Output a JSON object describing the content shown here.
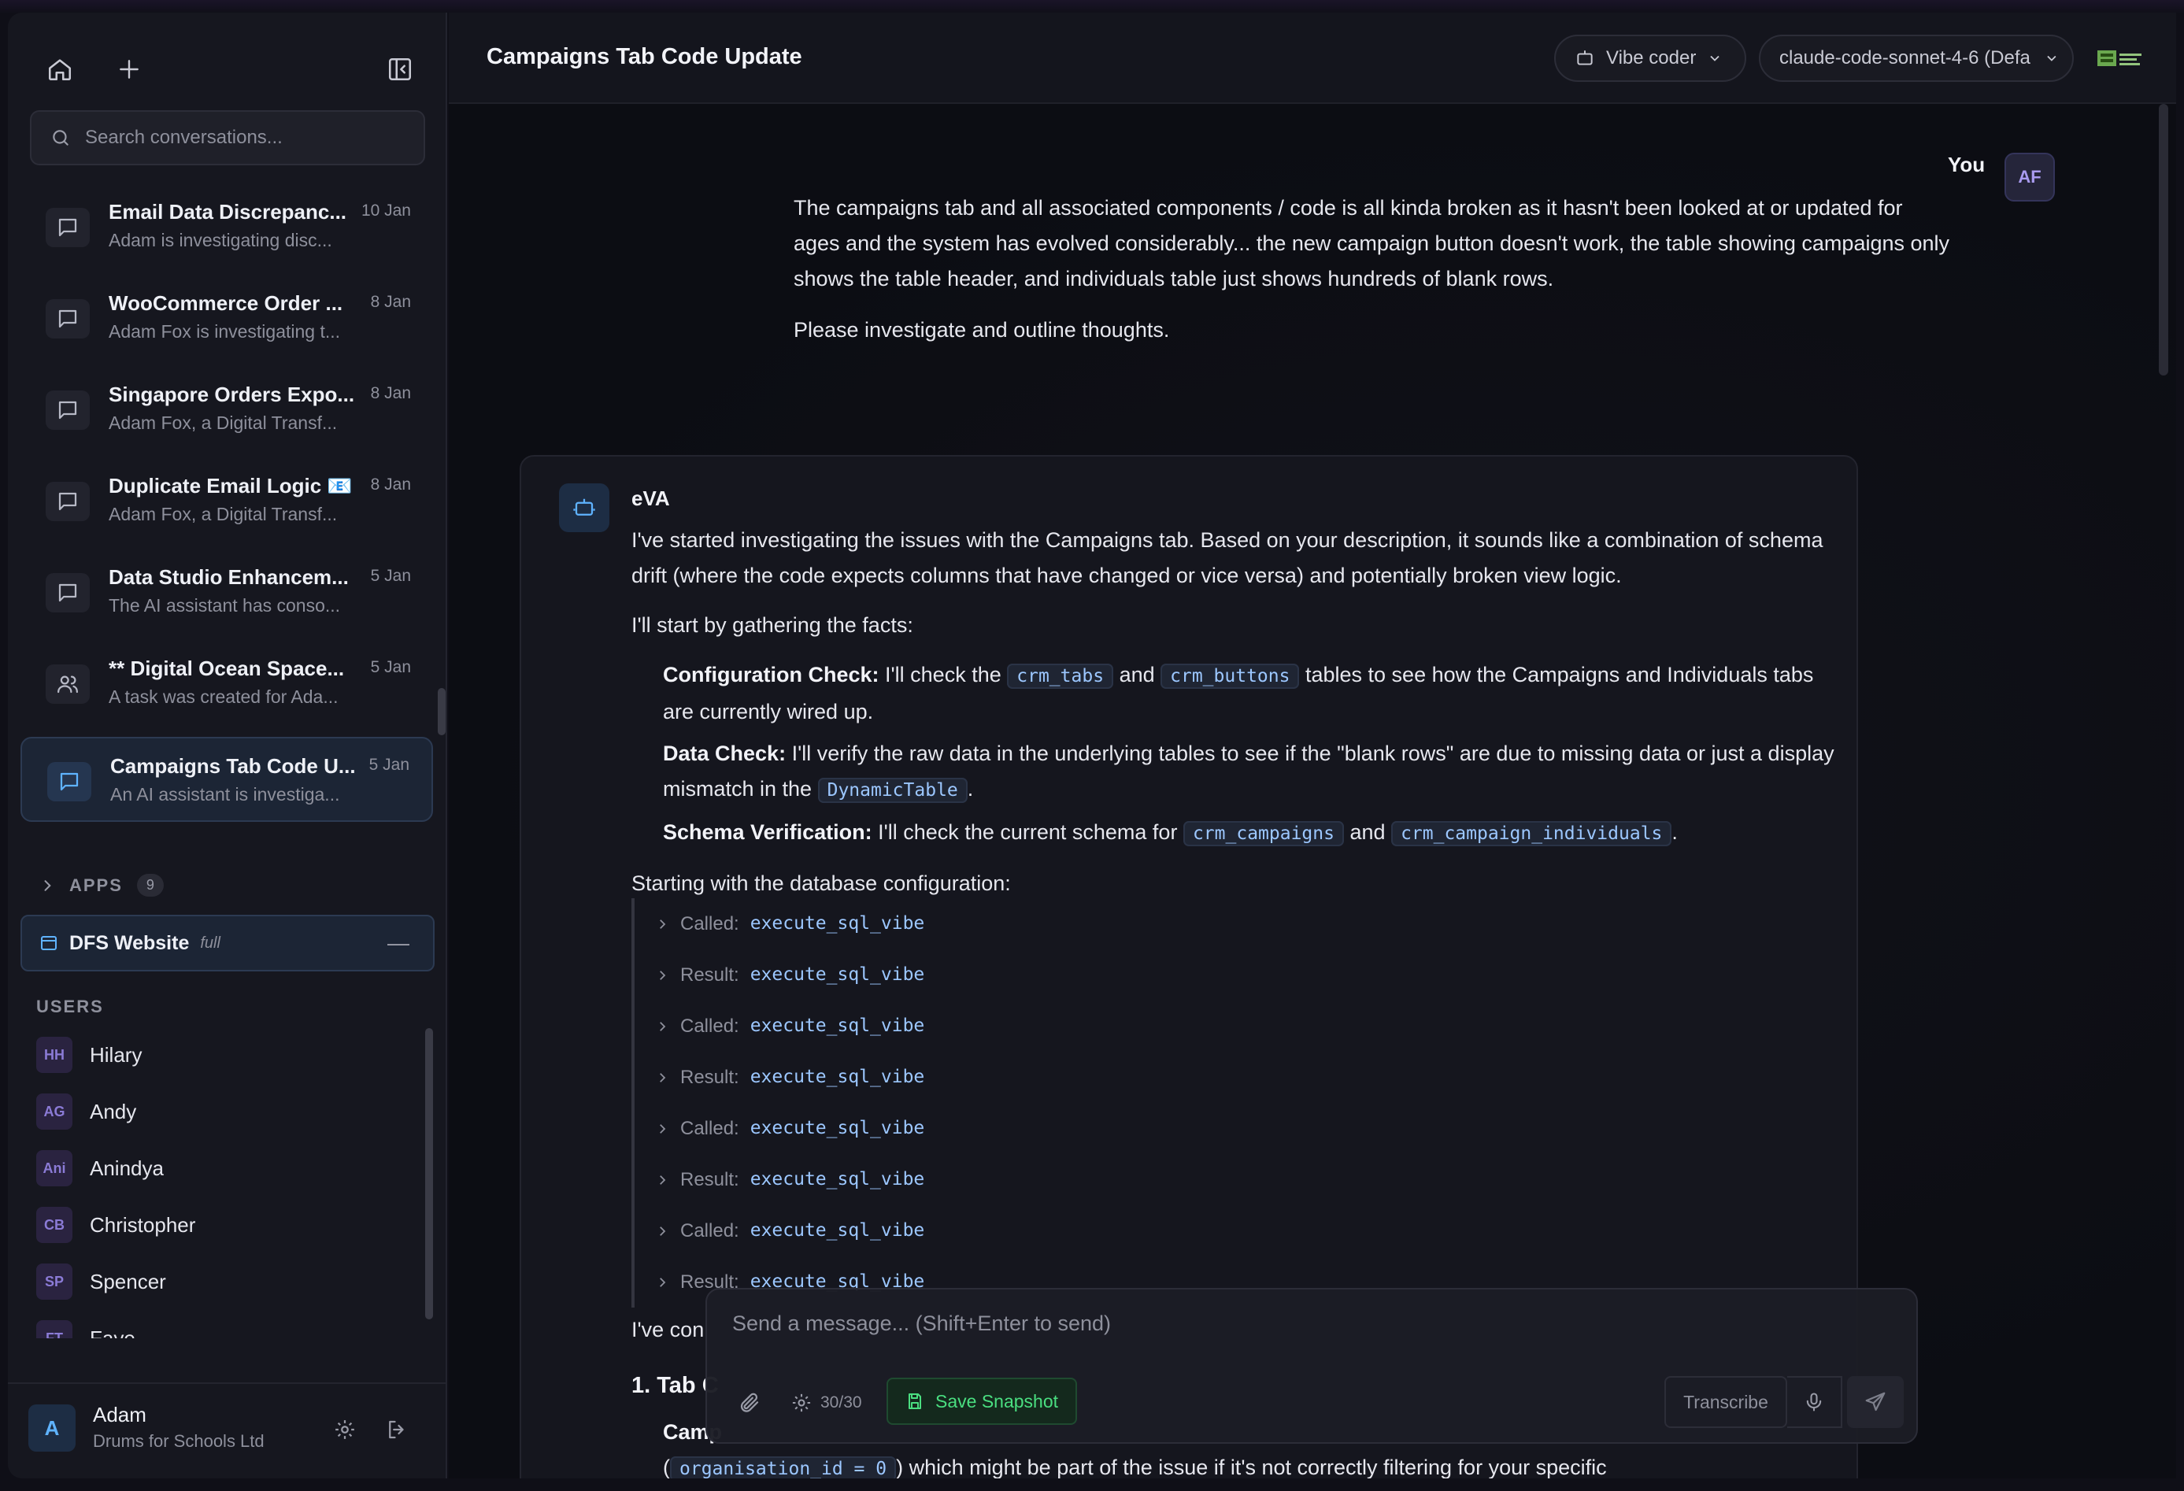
{
  "sidebar": {
    "search_placeholder": "Search conversations...",
    "conversations": [
      {
        "title": "Email Data Discrepanc...",
        "subtitle": "Adam is investigating disc...",
        "date": "10 Jan"
      },
      {
        "title": "WooCommerce Order ...",
        "subtitle": "Adam Fox is investigating t...",
        "date": "8 Jan"
      },
      {
        "title": "Singapore Orders Expo...",
        "subtitle": "Adam Fox, a Digital Transf...",
        "date": "8 Jan"
      },
      {
        "title": "Duplicate Email Logic 📧",
        "subtitle": "Adam Fox, a Digital Transf...",
        "date": "8 Jan"
      },
      {
        "title": "Data Studio Enhancem...",
        "subtitle": "The AI assistant has conso...",
        "date": "5 Jan"
      },
      {
        "title": "** Digital Ocean Space...",
        "subtitle": "A task was created for Ada...",
        "date": "5 Jan"
      },
      {
        "title": "Campaigns Tab Code U...",
        "subtitle": "An AI assistant is investiga...",
        "date": "5 Jan"
      }
    ],
    "apps_label": "APPS",
    "apps_count": "9",
    "app": {
      "name": "DFS Website",
      "tag": "full"
    },
    "users_label": "USERS",
    "users": [
      {
        "initials": "HH",
        "name": "Hilary"
      },
      {
        "initials": "AG",
        "name": "Andy"
      },
      {
        "initials": "Ani",
        "name": "Anindya"
      },
      {
        "initials": "CB",
        "name": "Christopher"
      },
      {
        "initials": "SP",
        "name": "Spencer"
      },
      {
        "initials": "FT",
        "name": "Faye"
      }
    ],
    "footer": {
      "initial": "A",
      "name": "Adam",
      "org": "Drums for Schools Ltd"
    }
  },
  "header": {
    "title": "Campaigns Tab Code Update",
    "mode": "Vibe coder",
    "model": "claude-code-sonnet-4-6 (Defa"
  },
  "chat": {
    "user_label": "You",
    "user_initials": "AF",
    "user_message_1": "The campaigns tab and all associated components / code is all kinda broken as it hasn't been looked at or updated for ages and the system has evolved considerably... the new campaign button doesn't work, the table showing campaigns only shows the table header, and individuals table just shows hundreds of blank rows.",
    "user_message_2": "Please investigate and outline thoughts.",
    "ai_name": "eVA",
    "ai_intro": "I've started investigating the issues with the Campaigns tab. Based on your description, it sounds like a combination of schema drift (where the code expects columns that have changed or vice versa) and potentially broken view logic.",
    "ai_gather": "I'll start by gathering the facts:",
    "b1_label": "Configuration Check:",
    "b1_a": "I'll check the",
    "b1_code1": "crm_tabs",
    "b1_and": "and",
    "b1_code2": "crm_buttons",
    "b1_b": "tables to see how the Campaigns and Individuals tabs are currently wired up.",
    "b2_label": "Data Check:",
    "b2_a": "I'll verify the raw data in the underlying tables to see if the \"blank rows\" are due to missing data or just a display mismatch in the",
    "b2_code": "DynamicTable",
    "b2_end": ".",
    "b3_label": "Schema Verification:",
    "b3_a": "I'll check the current schema for",
    "b3_code1": "crm_campaigns",
    "b3_and": "and",
    "b3_code2": "crm_campaign_individuals",
    "b3_end": ".",
    "ai_starting": "Starting with the database configuration:",
    "tools": [
      {
        "kind": "Called:",
        "name": "execute_sql_vibe"
      },
      {
        "kind": "Result:",
        "name": "execute_sql_vibe"
      },
      {
        "kind": "Called:",
        "name": "execute_sql_vibe"
      },
      {
        "kind": "Result:",
        "name": "execute_sql_vibe"
      },
      {
        "kind": "Called:",
        "name": "execute_sql_vibe"
      },
      {
        "kind": "Result:",
        "name": "execute_sql_vibe"
      },
      {
        "kind": "Called:",
        "name": "execute_sql_vibe"
      },
      {
        "kind": "Result:",
        "name": "execute_sql_vibe"
      }
    ],
    "partial_1": "I've con",
    "partial_heading": "1. Tab C",
    "partial_2_label": "Camp",
    "partial_3_code": "organisation_id = 0",
    "partial_3_text": "which might be part of the issue if it's not correctly filtering for your specific"
  },
  "composer": {
    "placeholder": "Send a message... (Shift+Enter to send)",
    "counter": "30/30",
    "snapshot_label": "Save Snapshot",
    "transcribe_label": "Transcribe"
  }
}
